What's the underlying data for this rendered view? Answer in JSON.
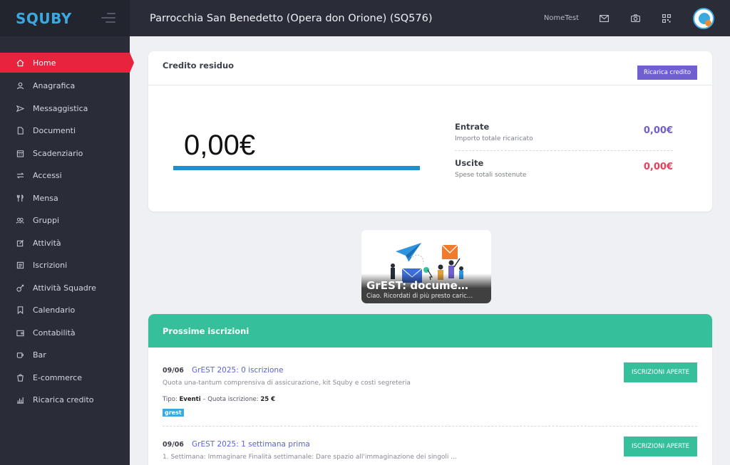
{
  "app": {
    "logo": "SQUBY",
    "page_title": "Parrocchia San Benedetto (Opera don Orione) (SQ576)",
    "username": "NomeTest"
  },
  "colors": {
    "sidebar_bg": "#2a2d38",
    "active": "#e8233e",
    "accent_purple": "#6f5fcf",
    "accent_green": "#36bf9b",
    "accent_blue": "#3aa9e0",
    "negative": "#e8405a"
  },
  "sidebar": {
    "items": [
      {
        "label": "Home",
        "icon": "home-icon"
      },
      {
        "label": "Anagrafica",
        "icon": "user-icon"
      },
      {
        "label": "Messaggistica",
        "icon": "send-icon"
      },
      {
        "label": "Documenti",
        "icon": "file-icon"
      },
      {
        "label": "Scadenziario",
        "icon": "calendar-icon"
      },
      {
        "label": "Accessi",
        "icon": "swap-icon"
      },
      {
        "label": "Mensa",
        "icon": "cutlery-icon"
      },
      {
        "label": "Gruppi",
        "icon": "group-icon"
      },
      {
        "label": "Attività",
        "icon": "edit-icon"
      },
      {
        "label": "Iscrizioni",
        "icon": "list-icon"
      },
      {
        "label": "Attività Squadre",
        "icon": "whistle-icon"
      },
      {
        "label": "Calendario",
        "icon": "bookmark-icon"
      },
      {
        "label": "Contabilità",
        "icon": "wallet-icon"
      },
      {
        "label": "Bar",
        "icon": "cup-icon"
      },
      {
        "label": "E-commerce",
        "icon": "cart-icon"
      },
      {
        "label": "Ricarica credito",
        "icon": "chart-icon"
      }
    ]
  },
  "credit": {
    "title": "Credito residuo",
    "button": "Ricarica credito",
    "balance": "0,00€",
    "entrate": {
      "label": "Entrate",
      "sub": "Importo totale ricaricato",
      "value": "0,00€"
    },
    "uscite": {
      "label": "Uscite",
      "sub": "Spese totali sostenute",
      "value": "0,00€"
    }
  },
  "promo": {
    "title": "GrEST: documenti",
    "subtitle": "Ciao. Ricordati di più presto caricare i documenti"
  },
  "iscrizioni": {
    "title": "Prossime iscrizioni",
    "items": [
      {
        "date": "09/06",
        "name": "GrEST 2025: 0 iscrizione",
        "desc": "Quota una-tantum comprensiva di assicurazione, kit Squby e costi segreteria",
        "tipo_label": "Tipo:",
        "tipo": "Eventi",
        "quota_label": "Quota iscrizione:",
        "quota": "25 €",
        "tag": "grest",
        "button": "ISCRIZIONI APERTE"
      },
      {
        "date": "09/06",
        "name": "GrEST 2025: 1 settimana prima",
        "desc": "1. Settimana: Immaginare Finalità settimanale: Dare spazio all'immaginazione dei singoli ...",
        "button": "ISCRIZIONI APERTE"
      }
    ]
  }
}
